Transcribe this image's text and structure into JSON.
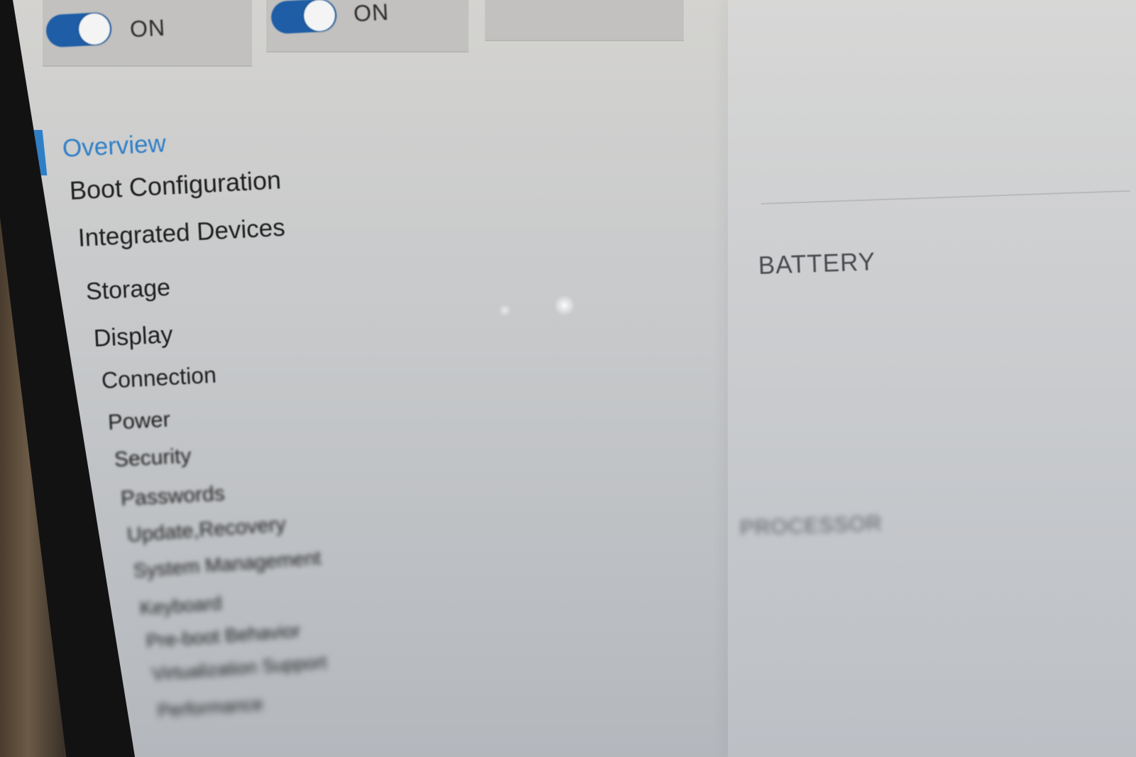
{
  "toggles": [
    {
      "state_label": "ON",
      "on": true
    },
    {
      "state_label": "ON",
      "on": true
    }
  ],
  "sidebar": {
    "selected": "Overview",
    "items": [
      {
        "label": "Overview"
      },
      {
        "label": "Boot Configuration"
      },
      {
        "label": "Integrated Devices"
      },
      {
        "label": "Storage"
      },
      {
        "label": "Display"
      },
      {
        "label": "Connection"
      },
      {
        "label": "Power"
      },
      {
        "label": "Security"
      },
      {
        "label": "Passwords"
      },
      {
        "label": "Update,Recovery"
      },
      {
        "label": "System Management"
      },
      {
        "label": "Keyboard"
      },
      {
        "label": "Pre-boot Behavior"
      },
      {
        "label": "Virtualization Support"
      },
      {
        "label": "Performance"
      }
    ]
  },
  "main": {
    "battery_heading": "BATTERY",
    "processor_heading": "PROCESSOR"
  },
  "colors": {
    "accent": "#2f7fc7",
    "toggle_on": "#1f5ea6",
    "text": "#1e1e1e"
  }
}
